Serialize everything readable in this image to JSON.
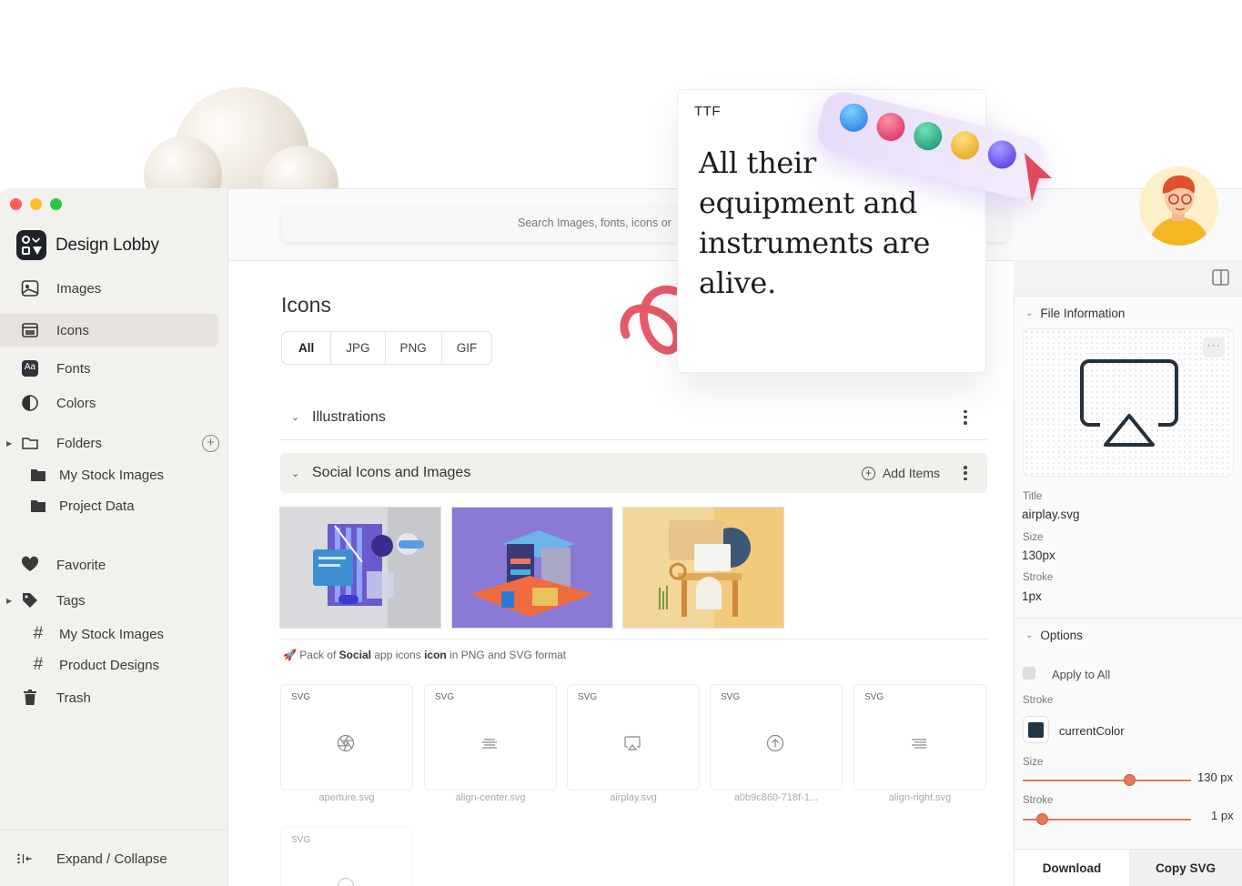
{
  "app": {
    "name": "Design Lobby"
  },
  "search": {
    "placeholder": "Search Images, fonts, icons or"
  },
  "sidebar": {
    "items": [
      {
        "label": "Images"
      },
      {
        "label": "Icons"
      },
      {
        "label": "Fonts"
      },
      {
        "label": "Colors"
      },
      {
        "label": "Folders"
      },
      {
        "label": "My Stock Images"
      },
      {
        "label": "Project Data"
      },
      {
        "label": "Favorite"
      },
      {
        "label": "Tags"
      },
      {
        "label": "My Stock Images"
      },
      {
        "label": "Product Designs"
      },
      {
        "label": "Trash"
      }
    ],
    "footer": "Expand / Collapse",
    "fonts_badge": "Aa"
  },
  "main": {
    "title": "Icons",
    "tabs": [
      "All",
      "JPG",
      "PNG",
      "GIF"
    ],
    "sections": [
      {
        "title": "Illustrations"
      },
      {
        "title": "Social Icons and Images",
        "add_label": "Add Items"
      }
    ],
    "caption": {
      "prefix": "Pack of ",
      "bold1": "Social",
      "mid": " app icons ",
      "bold2": "icon",
      "suffix": " in PNG and SVG format"
    },
    "cards": [
      {
        "type": "SVG",
        "file": "aperture.svg",
        "icon": "aperture-icon"
      },
      {
        "type": "SVG",
        "file": "align-center.svg",
        "icon": "align-center-icon"
      },
      {
        "type": "SVG",
        "file": "airplay.svg",
        "icon": "airplay-icon"
      },
      {
        "type": "SVG",
        "file": "a0b9c860-718f-1...",
        "icon": "arrow-up-circle-icon"
      },
      {
        "type": "SVG",
        "file": "align-right.svg",
        "icon": "align-right-icon"
      },
      {
        "type": "SVG",
        "file": "",
        "icon": "circle-icon"
      }
    ]
  },
  "details": {
    "file_info_label": "File Information",
    "title_label": "Title",
    "title_value": "airplay.svg",
    "size_label": "Size",
    "size_value": "130px",
    "stroke_label": "Stroke",
    "stroke_value": "1px",
    "options_label": "Options",
    "apply_all": "Apply to All",
    "stroke_color_label": "Stroke",
    "stroke_color": "currentColor",
    "size_slider_label": "Size",
    "size_slider_value": "130 px",
    "size_slider_fraction": 0.64,
    "stroke_slider_label": "Stroke",
    "stroke_slider_value": "1 px",
    "stroke_slider_fraction": 0.12,
    "download": "Download",
    "copy": "Copy SVG"
  },
  "promo": {
    "ttf_label": "TTF",
    "quote": "All their equipment and instruments are alive."
  },
  "colors": {
    "accent": "#e6765a",
    "stroke_swatch": "#243447",
    "palette": [
      "#3b82f6",
      "#e23a6a",
      "#1fa88a",
      "#f0b62e",
      "#6a4ef5"
    ]
  }
}
